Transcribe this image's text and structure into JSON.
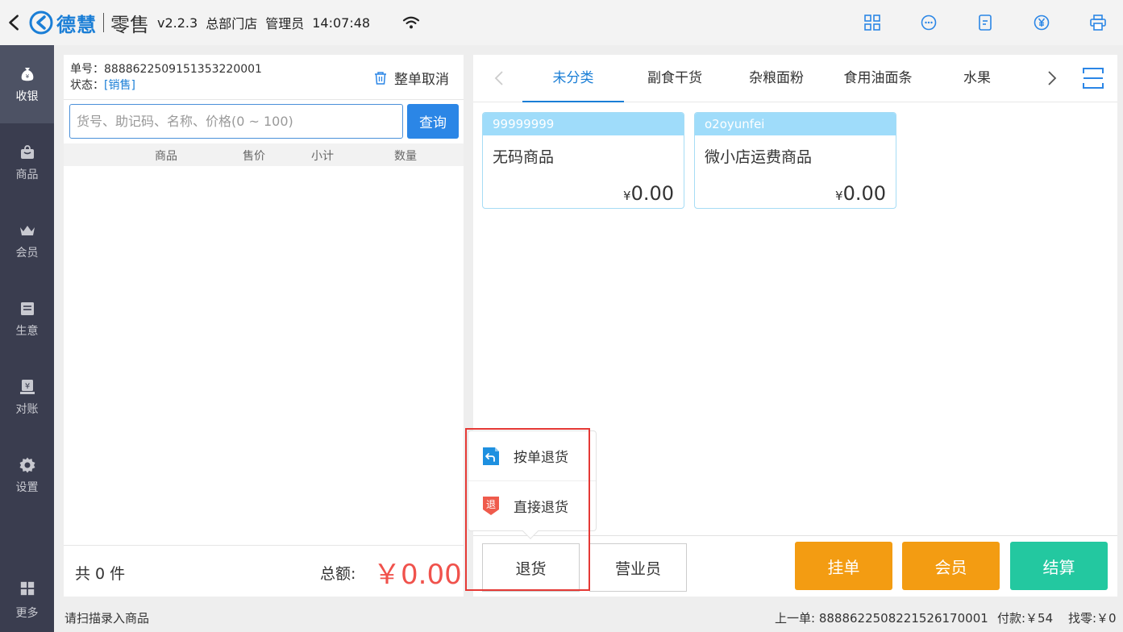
{
  "topbar": {
    "brand": "德慧",
    "module": "零售",
    "version": "v2.2.3",
    "store": "总部门店",
    "role": "管理员",
    "time": "14:07:48"
  },
  "sidebar": {
    "items": [
      {
        "label": "收银",
        "icon": "money-bag-icon"
      },
      {
        "label": "商品",
        "icon": "bag-icon"
      },
      {
        "label": "会员",
        "icon": "crown-icon"
      },
      {
        "label": "生意",
        "icon": "register-icon"
      },
      {
        "label": "对账",
        "icon": "yen-box-icon"
      },
      {
        "label": "设置",
        "icon": "gear-icon"
      }
    ],
    "more": "更多"
  },
  "order": {
    "number_label": "单号：",
    "number": "8888622509151353220001",
    "status_label": "状态：",
    "status": "[销售]",
    "cancel_all": "整单取消"
  },
  "search": {
    "placeholder": "货号、助记码、名称、价格(0 ~ 100)",
    "button": "查询"
  },
  "table": {
    "columns": [
      "商品",
      "售价",
      "小计",
      "数量"
    ]
  },
  "summary": {
    "count": "共 0 件",
    "total_label": "总额:",
    "total": "￥0.00"
  },
  "categories": [
    "未分类",
    "副食干货",
    "杂粮面粉",
    "食用油面条",
    "水果"
  ],
  "products": [
    {
      "code": "99999999",
      "name": "无码商品",
      "currency": "¥",
      "price": "0.00"
    },
    {
      "code": "o2oyunfei",
      "name": "微小店运费商品",
      "currency": "¥",
      "price": "0.00"
    }
  ],
  "return_menu": {
    "by_order": "按单退货",
    "direct": "直接退货"
  },
  "actions": {
    "return": "退货",
    "clerk": "营业员",
    "hold": "挂单",
    "member": "会员",
    "checkout": "结算"
  },
  "status_bar": {
    "hint": "请扫描录入商品",
    "last_order": "上一单: 8888622508221526170001",
    "paid": "付款:￥54",
    "change": "找零:￥0"
  },
  "colors": {
    "accent": "#1a7ed6",
    "sidebar": "#3a3d4f",
    "orange": "#f39c12",
    "green": "#23c8a0",
    "price_red": "#f0524c"
  }
}
